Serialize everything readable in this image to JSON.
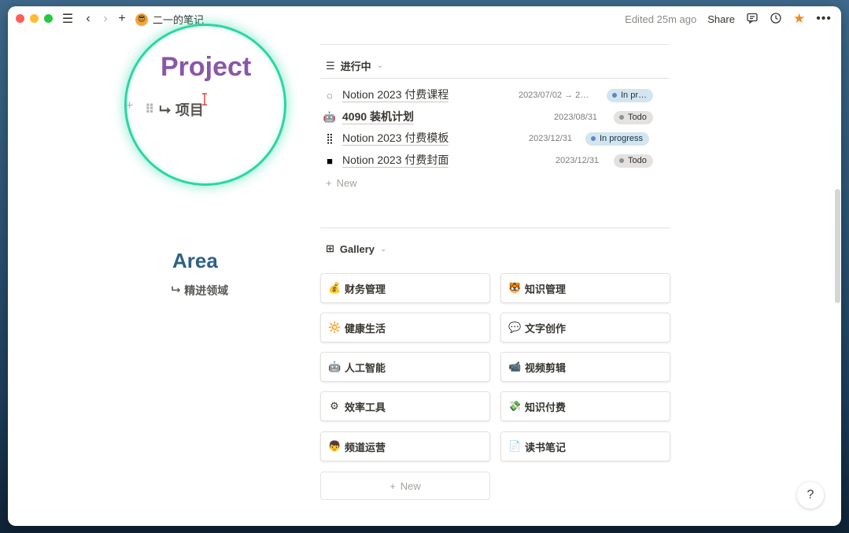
{
  "topbar": {
    "page_emoji": "😎",
    "page_title": "二一的笔记",
    "edited": "Edited 25m ago",
    "share": "Share"
  },
  "left": {
    "project_title": "Project",
    "project_sub_arrow": "⮡",
    "project_sub": "项目",
    "area_title": "Area",
    "area_sub_arrow": "⮡",
    "area_sub": "精进领域"
  },
  "in_progress_view": {
    "name": "进行中",
    "rows": [
      {
        "icon": "◌",
        "title": "Notion 2023 付费课程",
        "date": "2023/07/02 → 2…",
        "status": "In pr…",
        "status_type": "progress"
      },
      {
        "icon": "🤖",
        "title": "4090 装机计划",
        "date": "2023/08/31",
        "status": "Todo",
        "status_type": "todo"
      },
      {
        "icon": "⣿",
        "title": "Notion 2023 付费模板",
        "date": "2023/12/31",
        "status": "In progress",
        "status_type": "progress"
      },
      {
        "icon": "■",
        "title": "Notion 2023 付费封面",
        "date": "2023/12/31",
        "status": "Todo",
        "status_type": "todo"
      }
    ],
    "new_label": "New"
  },
  "gallery_view": {
    "name": "Gallery",
    "cards": [
      {
        "emoji": "💰",
        "label": "财务管理"
      },
      {
        "emoji": "🐯",
        "label": "知识管理"
      },
      {
        "emoji": "🔆",
        "label": "健康生活"
      },
      {
        "emoji": "💬",
        "label": "文字创作"
      },
      {
        "emoji": "🤖",
        "label": "人工智能"
      },
      {
        "emoji": "📹",
        "label": "视频剪辑"
      },
      {
        "emoji": "⚙",
        "label": "效率工具"
      },
      {
        "emoji": "💸",
        "label": "知识付费"
      },
      {
        "emoji": "👦",
        "label": "频道运营"
      },
      {
        "emoji": "📄",
        "label": "读书笔记"
      }
    ],
    "new_label": "New"
  },
  "help": "?"
}
